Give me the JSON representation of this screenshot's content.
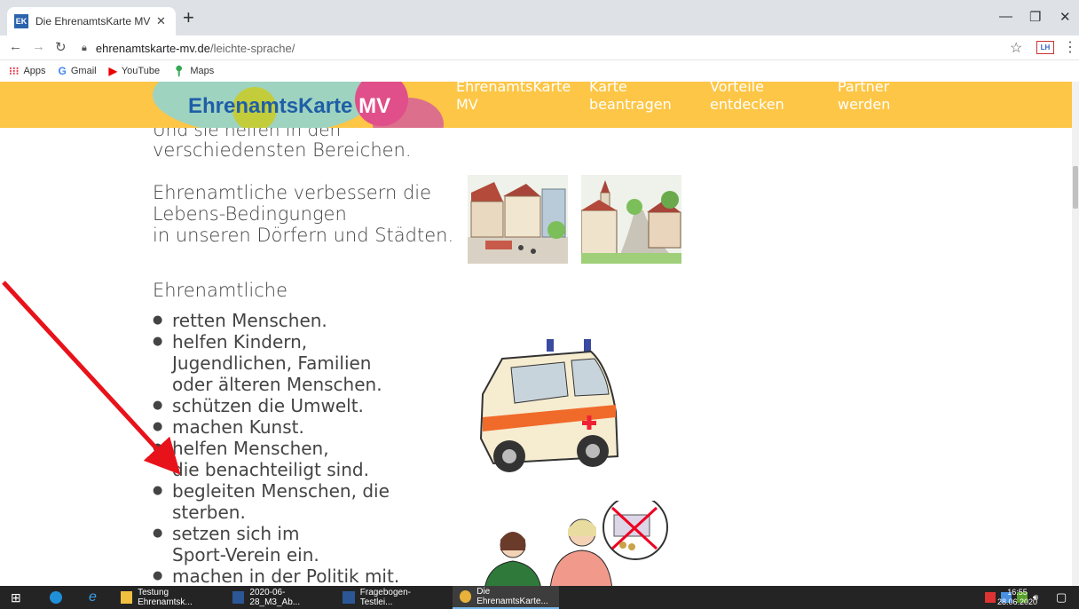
{
  "browser": {
    "tab_title": "Die EhrenamtsKarte MV",
    "tab_favicon": "EK",
    "new_tab_symbol": "+",
    "url_host": "ehrenamtskarte-mv.de",
    "url_path": "/leichte-sprache/",
    "bookmarks": [
      {
        "label": "Apps",
        "icon": "apps-icon"
      },
      {
        "label": "Gmail",
        "icon": "google-icon"
      },
      {
        "label": "YouTube",
        "icon": "youtube-icon"
      },
      {
        "label": "Maps",
        "icon": "maps-icon"
      }
    ],
    "extension_label": "LH"
  },
  "site": {
    "logo_part1": "Ehrenamts",
    "logo_part2": "Karte",
    "logo_part3": " MV",
    "nav": [
      {
        "line1": "EhrenamtsKarte",
        "line2": "MV"
      },
      {
        "line1": "Karte",
        "line2": "beantragen"
      },
      {
        "line1": "Vorteile",
        "line2": "entdecken"
      },
      {
        "line1": "Partner",
        "line2": "werden"
      }
    ],
    "accent_color": "#fdc646"
  },
  "content": {
    "cut_line": "Und sie helfen in den",
    "line_bereichen": "verschiedensten Bereichen.",
    "para2": [
      "Ehrenamtliche verbessern die",
      "Lebens-Bedingungen",
      "in unseren Dörfern und Städten."
    ],
    "heading_list": "Ehrenamtliche",
    "bullets": [
      [
        "retten Menschen."
      ],
      [
        "helfen Kindern,",
        "Jugendlichen, Familien",
        "oder älteren Menschen."
      ],
      [
        "schützen die Umwelt."
      ],
      [
        "machen Kunst."
      ],
      [
        "helfen Menschen,",
        "die benachteiligt sind."
      ],
      [
        "begleiten Menschen, die",
        "sterben."
      ],
      [
        "setzen sich im",
        "Sport-Verein ein."
      ],
      [
        "machen in der Politik mit."
      ]
    ]
  },
  "taskbar": {
    "items": [
      {
        "label": "Testung Ehrenamtsk...",
        "icon": "folder-icon"
      },
      {
        "label": "2020-06-28_M3_Ab...",
        "icon": "word-icon"
      },
      {
        "label": "Fragebogen-Testlei...",
        "icon": "word-icon"
      },
      {
        "label": "Die EhrenamtsKarte...",
        "icon": "chrome-icon"
      }
    ],
    "time": "16:55",
    "date": "28.06.2020"
  }
}
